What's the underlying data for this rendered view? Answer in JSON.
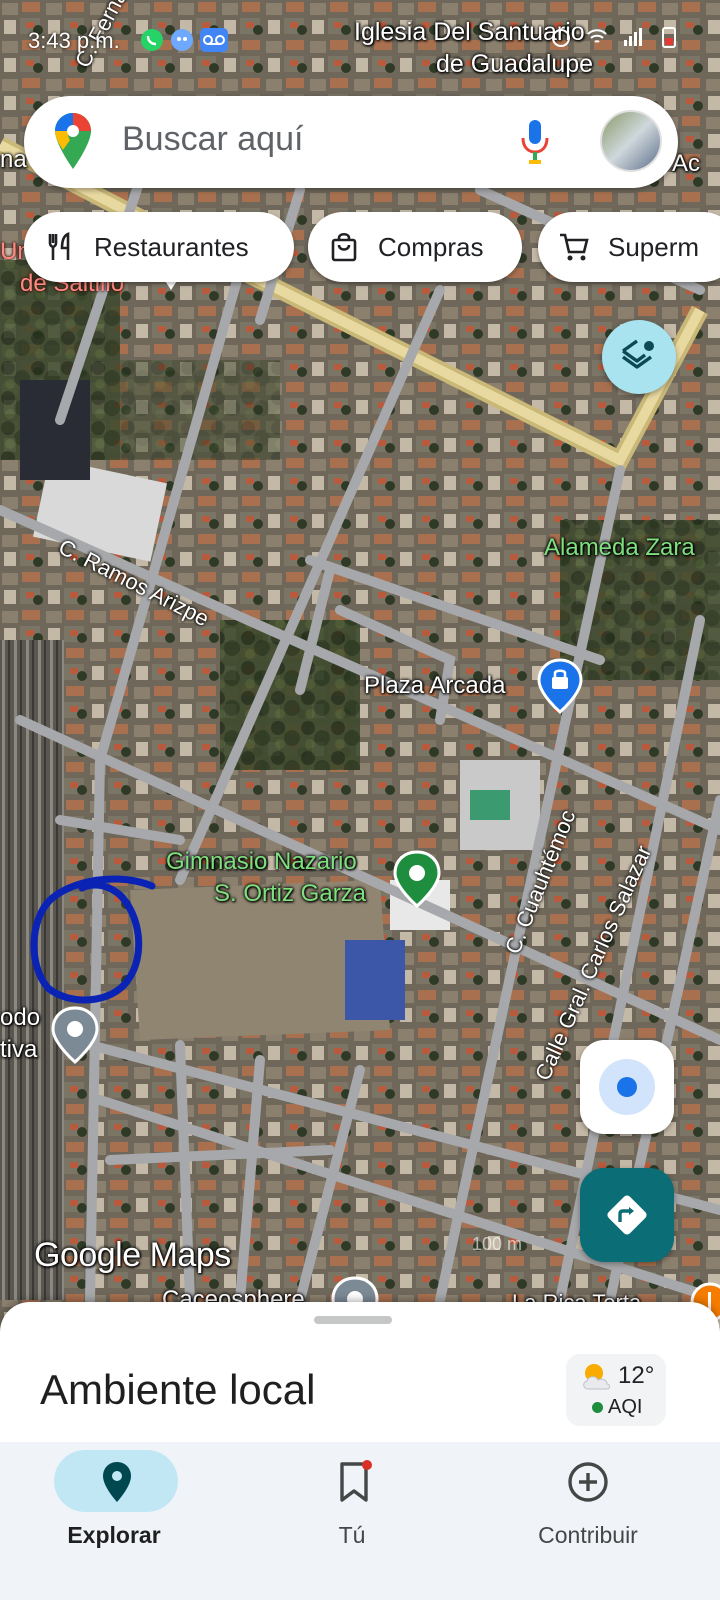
{
  "status_bar": {
    "time": "3:43 p.m."
  },
  "search": {
    "placeholder": "Buscar aquí",
    "logo_icon": "google-maps-pin-icon",
    "mic_icon": "microphone-icon"
  },
  "chips": [
    {
      "label": "Restaurantes",
      "icon": "fork-knife-icon"
    },
    {
      "label": "Compras",
      "icon": "shopping-bag-icon"
    },
    {
      "label": "Superm",
      "icon": "shopping-cart-icon"
    }
  ],
  "map_labels": {
    "church": "Iglesia Del Santuario de Guadalupe",
    "church_line1": "Iglesia Del Santuario",
    "church_line2": "de Guadalupe",
    "street_top_left": "C. Fernando Prado",
    "edge_left_1": "na",
    "edge_right_1": "Ac",
    "uni_line1": "Uni",
    "uni_line2": "de Saltillo",
    "ramos_arizpe": "C. Ramos Arizpe",
    "alameda": "Alameda Zara",
    "plaza_arcada": "Plaza Arcada",
    "gym_line1": "Gimnasio Nazario",
    "gym_line2": "S. Ortiz Garza",
    "cuauhtemoc": "C. Cuauhtémoc",
    "carlos_salazar": "Calle Gral. Carlos Salazar",
    "modo_line1": "odo",
    "modo_line2": "tiva",
    "bottom_left_partial": "Caceosphere",
    "bottom_right_partial": "La Rica Torta",
    "scale": "100 m",
    "watermark": "Google Maps"
  },
  "bottom_sheet": {
    "title": "Ambiente local",
    "weather": {
      "temp": "12°",
      "aqi_label": "AQI",
      "icon": "partly-cloudy-icon",
      "aqi_color": "#1e8e3e"
    }
  },
  "nav": [
    {
      "label": "Explorar",
      "icon": "location-pin-icon",
      "active": true
    },
    {
      "label": "Tú",
      "icon": "bookmark-icon",
      "active": false
    },
    {
      "label": "Contribuir",
      "icon": "add-circle-icon",
      "active": false
    }
  ],
  "colors": {
    "accent_blue": "#1a73e8",
    "directions_teal": "#0b6d75",
    "layers_bg": "#a9e3ef",
    "nav_active_pill": "#c2e7f4",
    "annotation_circle": "#0a23b5"
  }
}
